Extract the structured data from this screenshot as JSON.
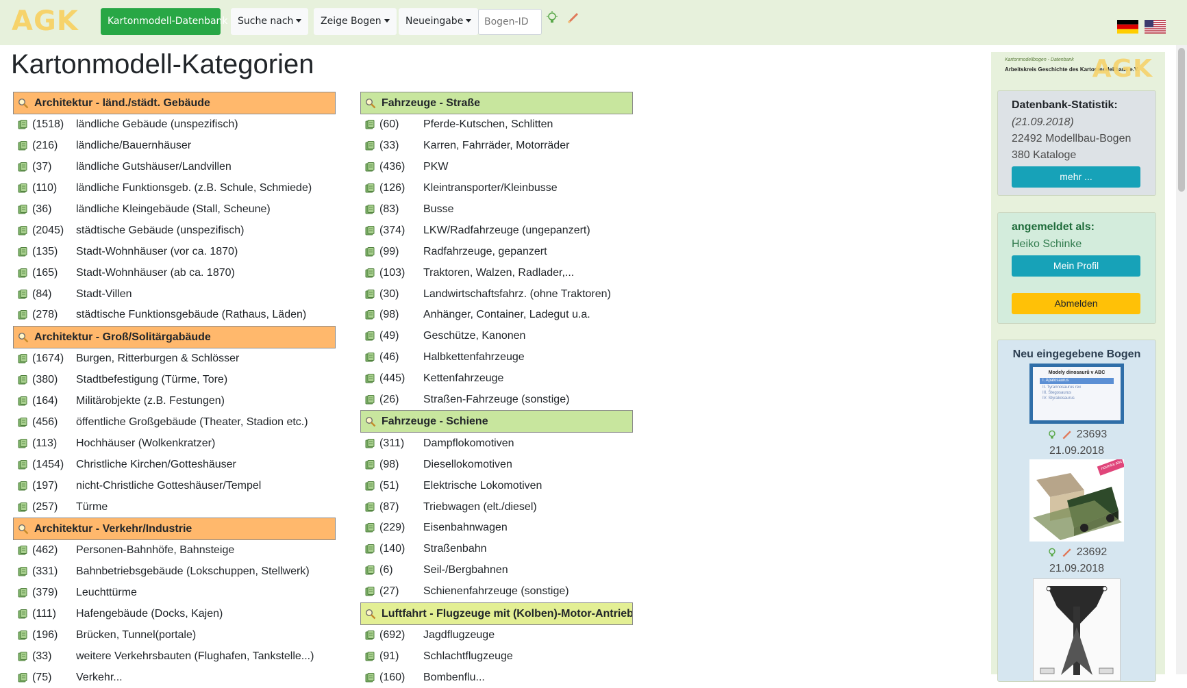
{
  "navbar": {
    "brand": "AGK",
    "db_button": "Kartonmodell-Datenbank",
    "search_menu": "Suche nach",
    "show_menu": "Zeige Bogen",
    "new_menu": "Neueingabe",
    "bogen_id_placeholder": "Bogen-ID"
  },
  "page_title": "Kartonmodell-Kategorien",
  "columns": [
    [
      {
        "title": "Architektur - länd./städt. Gebäude",
        "color": "orange",
        "items": [
          {
            "count": "(1518)",
            "label": "ländliche Gebäude (unspezifisch)"
          },
          {
            "count": "(216)",
            "label": "ländliche/Bauernhäuser"
          },
          {
            "count": "(37)",
            "label": "ländliche Gutshäuser/Landvillen"
          },
          {
            "count": "(110)",
            "label": "ländliche Funktionsgeb. (z.B. Schule, Schmiede)"
          },
          {
            "count": "(36)",
            "label": "ländliche Kleingebäude (Stall, Scheune)"
          },
          {
            "count": "(2045)",
            "label": "städtische Gebäude (unspezifisch)"
          },
          {
            "count": "(135)",
            "label": "Stadt-Wohnhäuser (vor ca. 1870)"
          },
          {
            "count": "(165)",
            "label": "Stadt-Wohnhäuser (ab ca. 1870)"
          },
          {
            "count": "(84)",
            "label": "Stadt-Villen"
          },
          {
            "count": "(278)",
            "label": "städtische Funktionsgebäude (Rathaus, Läden)"
          }
        ]
      },
      {
        "title": "Architektur - Groß/Solitärgabäude",
        "color": "orange",
        "items": [
          {
            "count": "(1674)",
            "label": "Burgen, Ritterburgen & Schlösser"
          },
          {
            "count": "(380)",
            "label": "Stadtbefestigung (Türme, Tore)"
          },
          {
            "count": "(164)",
            "label": "Militärobjekte (z.B. Festungen)"
          },
          {
            "count": "(456)",
            "label": "öffentliche Großgebäude (Theater, Stadion etc.)"
          },
          {
            "count": "(113)",
            "label": "Hochhäuser (Wolkenkratzer)"
          },
          {
            "count": "(1454)",
            "label": "Christliche Kirchen/Gotteshäuser"
          },
          {
            "count": "(197)",
            "label": "nicht-Christliche Gotteshäuser/Tempel"
          },
          {
            "count": "(257)",
            "label": "Türme"
          }
        ]
      },
      {
        "title": "Architektur - Verkehr/Industrie",
        "color": "orange",
        "items": [
          {
            "count": "(462)",
            "label": "Personen-Bahnhöfe, Bahnsteige"
          },
          {
            "count": "(331)",
            "label": "Bahnbetriebsgebäude (Lokschuppen, Stellwerk)"
          },
          {
            "count": "(379)",
            "label": "Leuchttürme"
          },
          {
            "count": "(111)",
            "label": "Hafengebäude (Docks, Kajen)"
          },
          {
            "count": "(196)",
            "label": "Brücken, Tunnel(portale)"
          },
          {
            "count": "(33)",
            "label": "weitere Verkehrsbauten (Flughafen, Tankstelle...)"
          },
          {
            "count": "(75)",
            "label": "Verkehr..."
          }
        ]
      }
    ],
    [
      {
        "title": "Fahrzeuge - Straße",
        "color": "green",
        "items": [
          {
            "count": "(60)",
            "label": "Pferde-Kutschen, Schlitten"
          },
          {
            "count": "(33)",
            "label": "Karren, Fahrräder, Motorräder"
          },
          {
            "count": "(436)",
            "label": "PKW"
          },
          {
            "count": "(126)",
            "label": "Kleintransporter/Kleinbusse"
          },
          {
            "count": "(83)",
            "label": "Busse"
          },
          {
            "count": "(374)",
            "label": "LKW/Radfahrzeuge (ungepanzert)"
          },
          {
            "count": "(99)",
            "label": "Radfahrzeuge, gepanzert"
          },
          {
            "count": "(103)",
            "label": "Traktoren, Walzen, Radlader,..."
          },
          {
            "count": "(30)",
            "label": "Landwirtschaftsfahrz. (ohne Traktoren)"
          },
          {
            "count": "(98)",
            "label": "Anhänger, Container, Ladegut u.a."
          },
          {
            "count": "(49)",
            "label": "Geschütze, Kanonen"
          },
          {
            "count": "(46)",
            "label": "Halbkettenfahrzeuge"
          },
          {
            "count": "(445)",
            "label": "Kettenfahrzeuge"
          },
          {
            "count": "(26)",
            "label": "Straßen-Fahrzeuge (sonstige)"
          }
        ]
      },
      {
        "title": "Fahrzeuge - Schiene",
        "color": "green",
        "items": [
          {
            "count": "(311)",
            "label": "Dampflokomotiven"
          },
          {
            "count": "(98)",
            "label": "Diesellokomotiven"
          },
          {
            "count": "(51)",
            "label": "Elektrische Lokomotiven"
          },
          {
            "count": "(87)",
            "label": "Triebwagen (elt./diesel)"
          },
          {
            "count": "(229)",
            "label": "Eisenbahnwagen"
          },
          {
            "count": "(140)",
            "label": "Straßenbahn"
          },
          {
            "count": "(6)",
            "label": "Seil-/Bergbahnen"
          },
          {
            "count": "(27)",
            "label": "Schienenfahrzeuge (sonstige)"
          }
        ]
      },
      {
        "title": "Luftfahrt - Flugzeuge mit (Kolben)-Motor-Antrieb",
        "color": "yellow",
        "items": [
          {
            "count": "(692)",
            "label": "Jagdflugzeuge"
          },
          {
            "count": "(91)",
            "label": "Schlachtflugzeuge"
          },
          {
            "count": "(160)",
            "label": "Bombenflu..."
          }
        ]
      }
    ]
  ],
  "sidebar": {
    "logo_line1": "Kartonmodellbogen - Datenbank",
    "logo_line2": "Arbeitskreis Geschichte des Kartonmodellbaus e.V.",
    "logo_text": "AGK",
    "stats": {
      "title": "Datenbank-Statistik:",
      "date": "(21.09.2018)",
      "sheets": "22492 Modellbau-Bogen",
      "catalogs": "380 Kataloge",
      "more_button": "mehr ..."
    },
    "login": {
      "title": "angemeldet als:",
      "user": "Heiko Schinke",
      "profile_button": "Mein Profil",
      "logout_button": "Abmelden"
    },
    "recent": {
      "title": "Neu eingegebene Bogen",
      "entries": [
        {
          "id": "23693",
          "date": "21.09.2018",
          "thumb_title": "Modely dinosaurů v ABC",
          "thumb_lines": [
            "I.   Apatosaurus",
            "II.  Tyrannosaurus rex",
            "III. Stegosaurus",
            "IV.  Styrakosaurus"
          ]
        },
        {
          "id": "23692",
          "date": "21.09.2018",
          "thumb_badge": "novinka abc"
        }
      ]
    }
  }
}
